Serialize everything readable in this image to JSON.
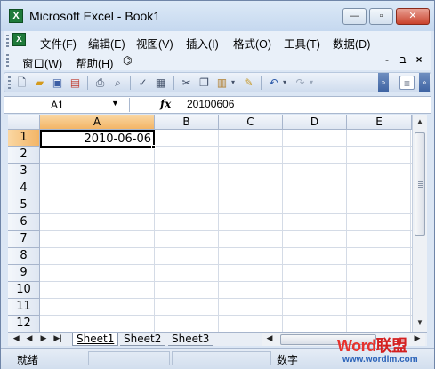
{
  "window": {
    "title": "Microsoft Excel - Book1",
    "icon": "excel-icon",
    "controls": {
      "minimize": "—",
      "restore": "▫",
      "close": "✕"
    }
  },
  "menubar": {
    "row1": [
      "文件(F)",
      "编辑(E)",
      "视图(V)",
      "插入(I)",
      "格式(O)",
      "工具(T)",
      "数据(D)"
    ],
    "row2": [
      "窗口(W)",
      "帮助(H)"
    ],
    "mdi_controls": {
      "minimize": "-",
      "restore": "ב",
      "close": "×"
    }
  },
  "toolbar": {
    "buttons": [
      "new-icon",
      "open-icon",
      "save-icon",
      "permission-icon",
      "print-icon",
      "print-preview-icon",
      "spelling-icon",
      "research-icon",
      "cut-icon",
      "copy-icon",
      "paste-icon",
      "format-painter-icon",
      "undo-icon",
      "redo-icon",
      "align-icon"
    ]
  },
  "formula_bar": {
    "name_box": "A1",
    "fx_label": "fx",
    "value": "20100606"
  },
  "grid": {
    "columns": [
      "A",
      "B",
      "C",
      "D",
      "E"
    ],
    "rows": [
      "1",
      "2",
      "3",
      "4",
      "5",
      "6",
      "7",
      "8",
      "9",
      "10",
      "11",
      "12"
    ],
    "active_column": "A",
    "active_row": "1",
    "cells": {
      "A1": "2010-06-06"
    }
  },
  "tabs": {
    "nav": [
      "|◀",
      "◀",
      "▶",
      "▶|"
    ],
    "sheets": [
      "Sheet1",
      "Sheet2",
      "Sheet3"
    ],
    "active": "Sheet1"
  },
  "statusbar": {
    "ready": "就绪",
    "mode": "数字"
  },
  "watermark": {
    "brand_latin": "Word",
    "brand_cn": "联盟",
    "url": "www.wordlm.com"
  },
  "colors": {
    "active_header": "#f3b566",
    "gridline": "#d4dbe6",
    "title_gradient_top": "#dce9f7"
  }
}
